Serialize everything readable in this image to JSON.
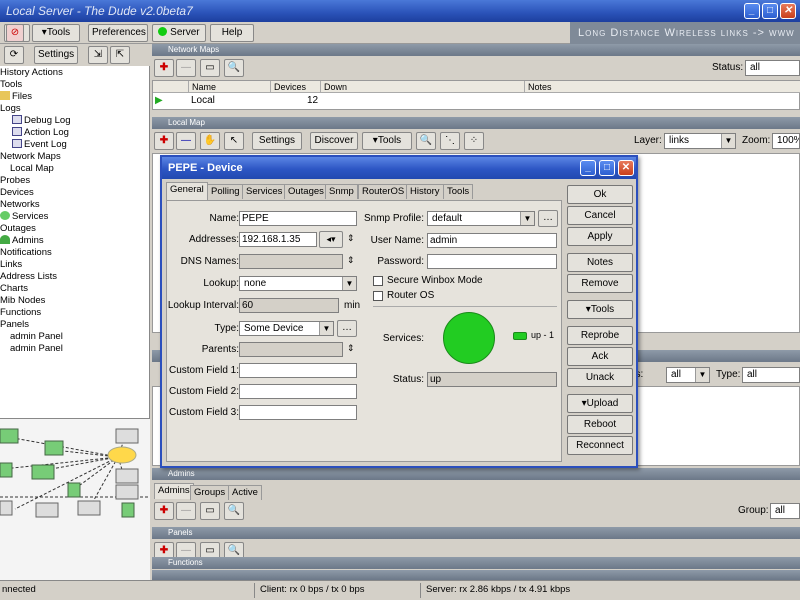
{
  "window": {
    "title": "Local Server - The Dude v2.0beta7"
  },
  "banner": "Long Distance Wireless links -> www",
  "toolbar": {
    "tools_label": "Tools",
    "preferences_label": "Preferences",
    "server_label": "Server",
    "help_label": "Help",
    "settings_label": "Settings"
  },
  "tree": {
    "items": [
      {
        "label": "History Actions"
      },
      {
        "label": "Tools"
      },
      {
        "label": "Files"
      },
      {
        "label": "Logs"
      },
      {
        "label": "Debug Log"
      },
      {
        "label": "Action Log"
      },
      {
        "label": "Event Log"
      },
      {
        "label": "Network Maps"
      },
      {
        "label": "Local Map"
      },
      {
        "label": "Probes"
      },
      {
        "label": "Devices"
      },
      {
        "label": "Networks"
      },
      {
        "label": "Services"
      },
      {
        "label": "Outages"
      },
      {
        "label": "Admins"
      },
      {
        "label": "Notifications"
      },
      {
        "label": "Links"
      },
      {
        "label": "Address Lists"
      },
      {
        "label": "Charts"
      },
      {
        "label": "Mib Nodes"
      },
      {
        "label": "Functions"
      },
      {
        "label": "Panels"
      },
      {
        "label": "admin Panel"
      },
      {
        "label": "admin Panel"
      }
    ]
  },
  "network_maps": {
    "title": "Network Maps",
    "status_label": "Status:",
    "status_value": "all",
    "columns": [
      "Name",
      "Devices",
      "Down",
      "Notes"
    ],
    "rows": [
      {
        "name": "Local",
        "devices": "12",
        "down": "",
        "notes": ""
      }
    ]
  },
  "local_map": {
    "title": "Local Map",
    "settings_label": "Settings",
    "discover_label": "Discover",
    "tools_label": "Tools",
    "layer_label": "Layer:",
    "layer_value": "links",
    "zoom_label": "Zoom:",
    "zoom_value": "100%"
  },
  "filter_row": {
    "status_suffix": "us:",
    "status_value": "all",
    "type_label": "Type:",
    "type_value": "all"
  },
  "admins": {
    "title": "Admins",
    "tabs": [
      "Admins",
      "Groups",
      "Active"
    ],
    "group_label": "Group:",
    "group_value": "all"
  },
  "panels_section": {
    "title": "Panels"
  },
  "functions_section": {
    "title": "Functions"
  },
  "dialog": {
    "title": "PEPE - Device",
    "tabs": [
      "General",
      "Polling",
      "Services",
      "Outages",
      "Snmp",
      "RouterOS",
      "History",
      "Tools"
    ],
    "fields": {
      "name_label": "Name:",
      "name_value": "PEPE",
      "addresses_label": "Addresses:",
      "addresses_value": "192.168.1.35",
      "dns_label": "DNS Names:",
      "lookup_label": "Lookup:",
      "lookup_value": "none",
      "lookup_interval_label": "Lookup Interval:",
      "lookup_interval_value": "60",
      "lookup_interval_unit": "min",
      "type_label": "Type:",
      "type_value": "Some Device",
      "parents_label": "Parents:",
      "custom1_label": "Custom Field 1:",
      "custom2_label": "Custom Field 2:",
      "custom3_label": "Custom Field 3:",
      "snmp_profile_label": "Snmp Profile:",
      "snmp_profile_value": "default",
      "username_label": "User Name:",
      "username_value": "admin",
      "password_label": "Password:",
      "secure_winbox_label": "Secure Winbox Mode",
      "router_os_label": "Router OS",
      "services_label": "Services:",
      "services_legend": "up - 1",
      "status_label": "Status:",
      "status_value": "up"
    },
    "buttons": [
      "Ok",
      "Cancel",
      "Apply",
      "Notes",
      "Remove",
      "Tools",
      "Reprobe",
      "Ack",
      "Unack",
      "Upload",
      "Reboot",
      "Reconnect"
    ],
    "colors": {
      "up": "#22cc22"
    }
  },
  "statusbar": {
    "connection": "nnected",
    "client": "Client: rx 0 bps / tx 0 bps",
    "server": "Server: rx 2.86 kbps / tx 4.91 kbps"
  }
}
